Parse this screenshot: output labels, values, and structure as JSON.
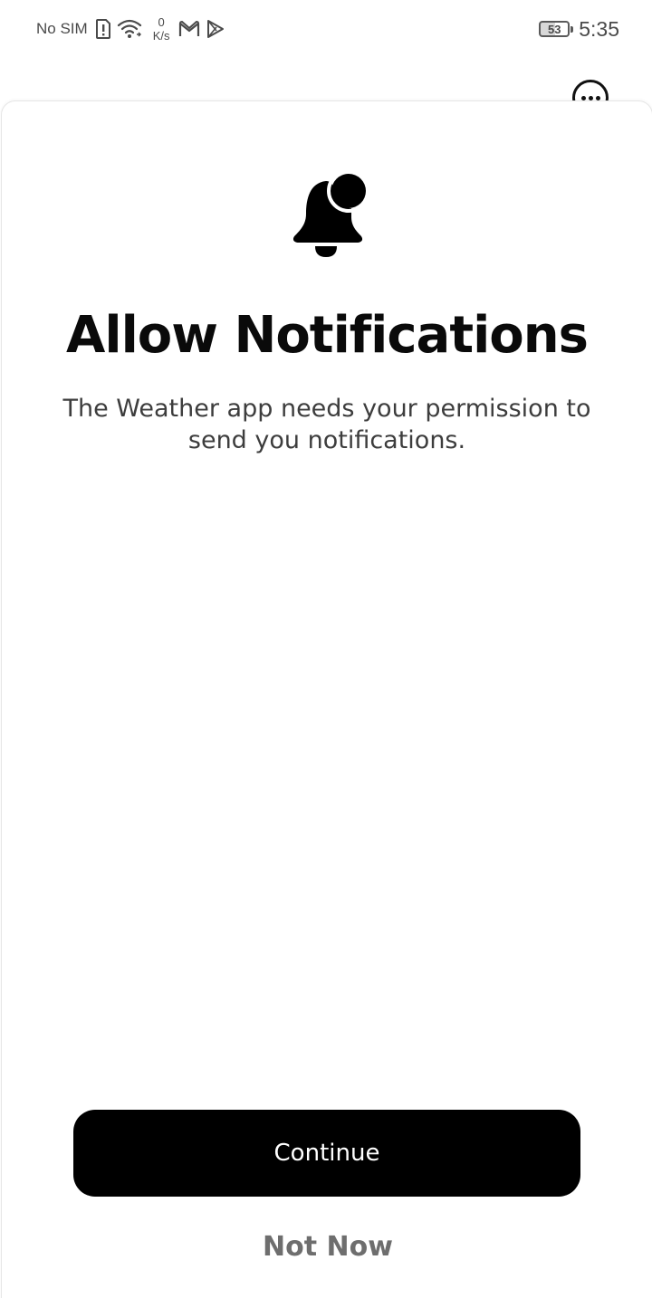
{
  "status_bar": {
    "carrier": "No SIM",
    "net_speed_value": "0",
    "net_speed_unit": "K/s",
    "battery_level": "53",
    "time": "5:35",
    "icons": [
      "sim-alert-icon",
      "wifi-icon",
      "gmail-icon",
      "play-store-icon"
    ]
  },
  "dialog": {
    "icon": "notification-bell-icon",
    "title": "Allow Notifications",
    "message": "The Weather app needs your permission to send you notifications.",
    "continue_label": "Continue",
    "not_now_label": "Not Now"
  },
  "background": {
    "more_icon": "more-options-icon"
  },
  "colors": {
    "primary_button": "#000000",
    "primary_button_text": "#ffffff",
    "secondary_text": "#6e6e6e",
    "title_text": "#0a0a0a"
  }
}
